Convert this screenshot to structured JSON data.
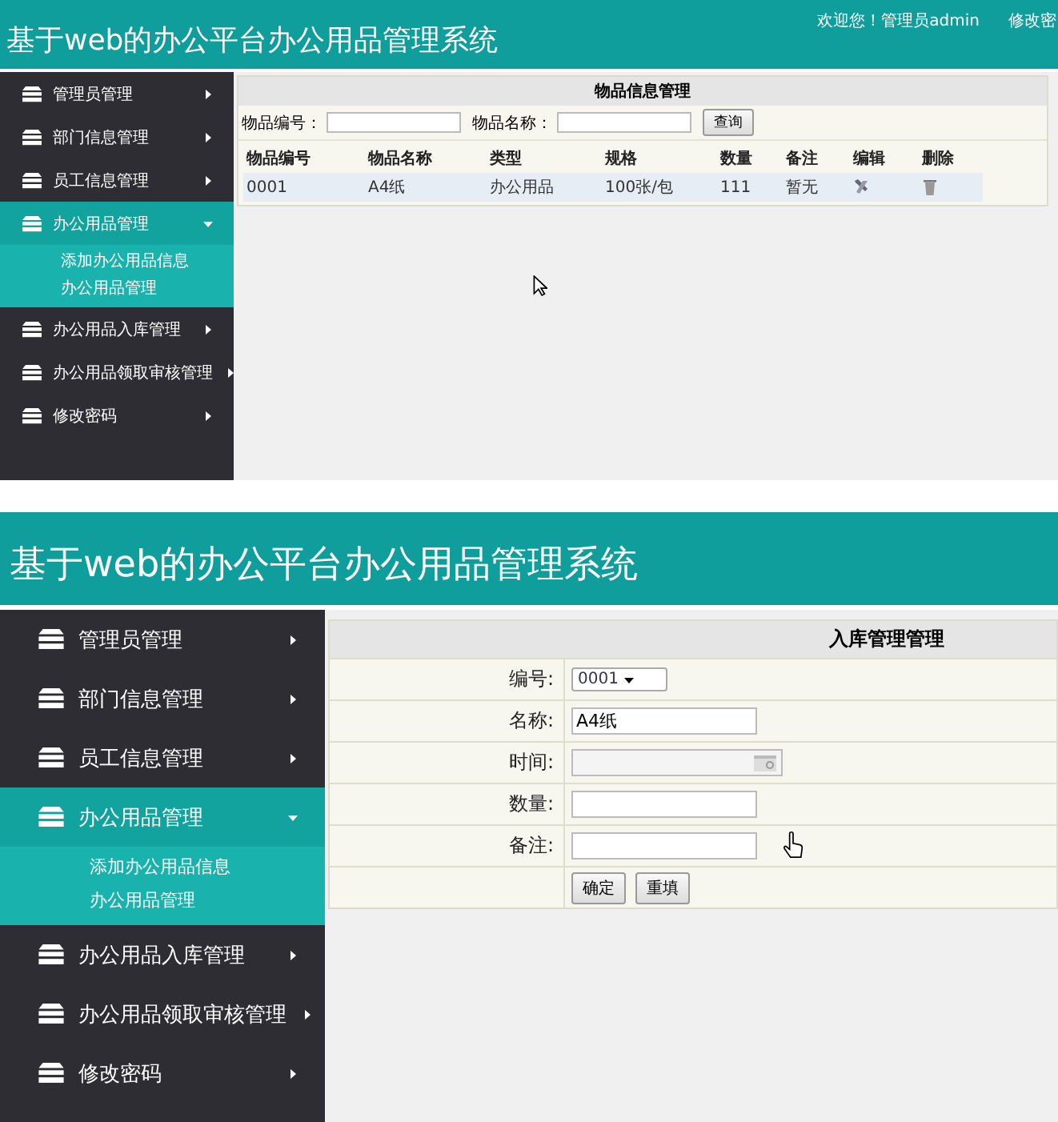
{
  "panels": [
    {
      "header": {
        "title": "基于web的办公平台办公用品管理系统",
        "welcome": "欢迎您！管理员admin",
        "link": "修改密"
      },
      "sidebar": {
        "items": [
          {
            "label": "管理员管理",
            "selected": false,
            "expanded": false
          },
          {
            "label": "部门信息管理",
            "selected": false,
            "expanded": false
          },
          {
            "label": "员工信息管理",
            "selected": false,
            "expanded": false
          },
          {
            "label": "办公用品管理",
            "selected": true,
            "expanded": true,
            "children": [
              {
                "label": "添加办公用品信息"
              },
              {
                "label": "办公用品管理"
              }
            ]
          },
          {
            "label": "办公用品入库管理",
            "selected": false,
            "expanded": false
          },
          {
            "label": "办公用品领取审核管理",
            "selected": false,
            "expanded": false
          },
          {
            "label": "修改密码",
            "selected": false,
            "expanded": false
          }
        ]
      },
      "content": {
        "kind": "list",
        "title": "物品信息管理",
        "search": [
          {
            "label": "物品编号："
          },
          {
            "label": "物品名称："
          }
        ],
        "search_button": "查询",
        "columns": [
          {
            "label": "物品编号",
            "kind": "text"
          },
          {
            "label": "物品名称",
            "kind": "text"
          },
          {
            "label": "类型",
            "kind": "text"
          },
          {
            "label": "规格",
            "kind": "text"
          },
          {
            "label": "数量",
            "kind": "text"
          },
          {
            "label": "备注",
            "kind": "text"
          },
          {
            "label": "编辑",
            "kind": "edit"
          },
          {
            "label": "删除",
            "kind": "delete"
          }
        ],
        "rows": [
          {
            "cells": [
              "0001",
              "A4纸",
              "办公用品",
              "100张/包",
              "111",
              "暂无"
            ]
          }
        ]
      }
    },
    {
      "header": {
        "title": "基于web的办公平台办公用品管理系统"
      },
      "sidebar": {
        "items": [
          {
            "label": "管理员管理",
            "selected": false,
            "expanded": false
          },
          {
            "label": "部门信息管理",
            "selected": false,
            "expanded": false
          },
          {
            "label": "员工信息管理",
            "selected": false,
            "expanded": false
          },
          {
            "label": "办公用品管理",
            "selected": true,
            "expanded": true,
            "children": [
              {
                "label": "添加办公用品信息"
              },
              {
                "label": "办公用品管理"
              }
            ]
          },
          {
            "label": "办公用品入库管理",
            "selected": false,
            "expanded": false
          },
          {
            "label": "办公用品领取审核管理",
            "selected": false,
            "expanded": false
          },
          {
            "label": "修改密码",
            "selected": false,
            "expanded": false
          }
        ]
      },
      "content": {
        "kind": "form",
        "title": "入库管理管理",
        "fields": [
          {
            "label": "编号:",
            "kind": "select",
            "value": "0001"
          },
          {
            "label": "名称:",
            "kind": "text",
            "value": "A4纸"
          },
          {
            "label": "时间:",
            "kind": "date"
          },
          {
            "label": "数量:",
            "kind": "text"
          },
          {
            "label": "备注:",
            "kind": "text"
          }
        ],
        "buttons": [
          "确定",
          "重填"
        ]
      }
    }
  ]
}
